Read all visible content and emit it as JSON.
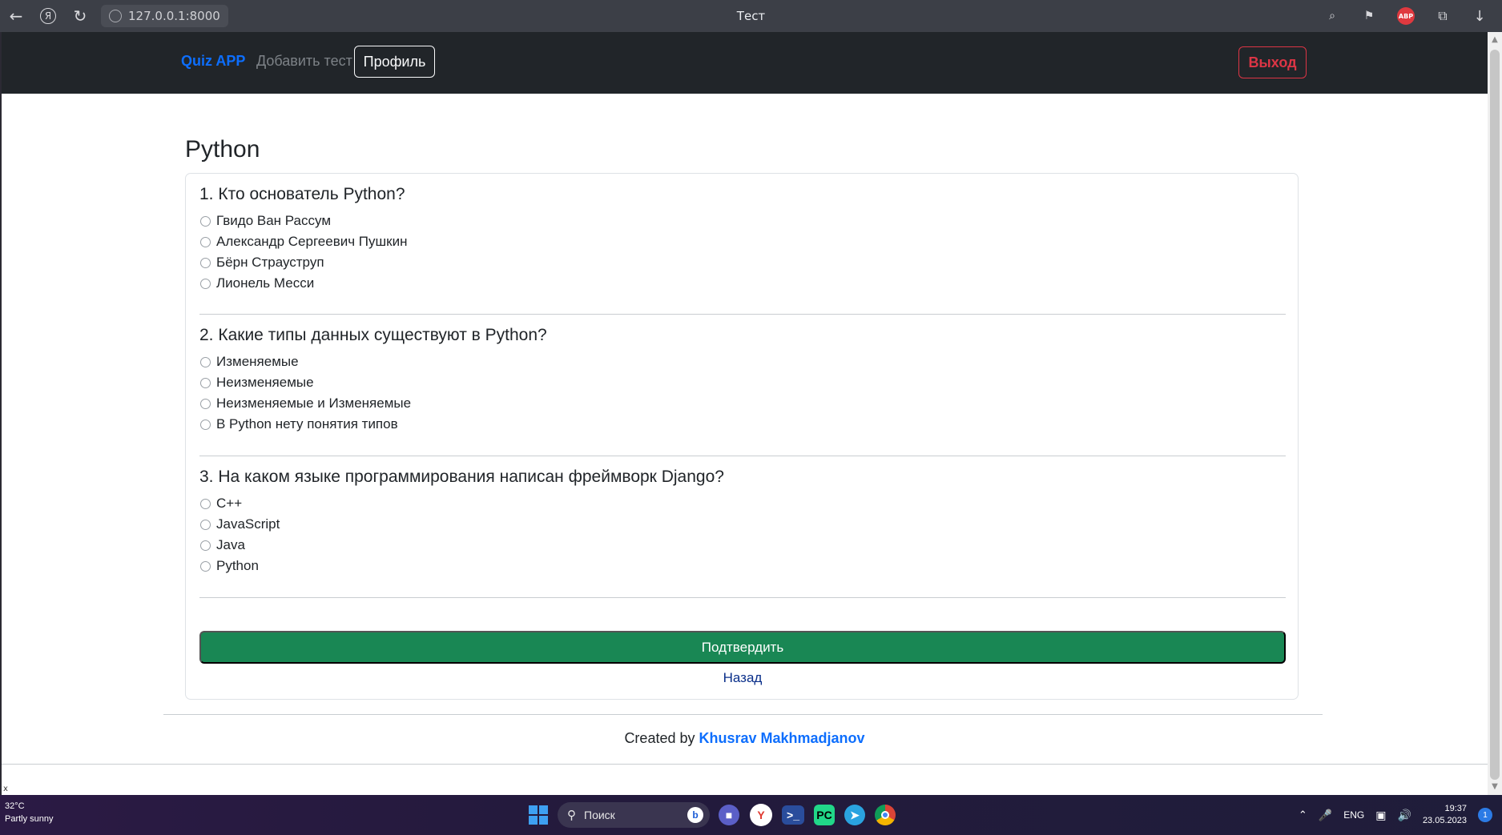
{
  "browser": {
    "url": "127.0.0.1:8000",
    "tab_title": "Тест",
    "abp_label": "ABP"
  },
  "navbar": {
    "brand": "Quiz APP",
    "add_test": "Добавить тест",
    "profile": "Профиль",
    "logout": "Выход"
  },
  "quiz": {
    "title": "Python",
    "questions": [
      {
        "title": "1. Кто основатель Python?",
        "options": [
          "Гвидо Ван Рассум",
          "Александр Сергеевич Пушкин",
          "Бёрн Страуструп",
          "Лионель Месси"
        ]
      },
      {
        "title": "2. Какие типы данных существуют в Python?",
        "options": [
          "Изменяемые",
          "Неизменяемые",
          "Неизменяемые и Изменяемые",
          "В Python нету понятия типов"
        ]
      },
      {
        "title": "3. На каком языке программирования написан фреймворк Django?",
        "options": [
          "C++",
          "JavaScript",
          "Java",
          "Python"
        ]
      }
    ],
    "submit": "Подтвердить",
    "back": "Назад"
  },
  "footer": {
    "created_by": "Created by ",
    "author": "Khusrav Makhmadjanov"
  },
  "misc": {
    "stray_x": "x"
  },
  "taskbar": {
    "weather_temp": "32°C",
    "weather_desc": "Partly sunny",
    "search_placeholder": "Поиск",
    "language": "ENG",
    "time": "19:37",
    "date": "23.05.2023",
    "notification_count": "1"
  }
}
